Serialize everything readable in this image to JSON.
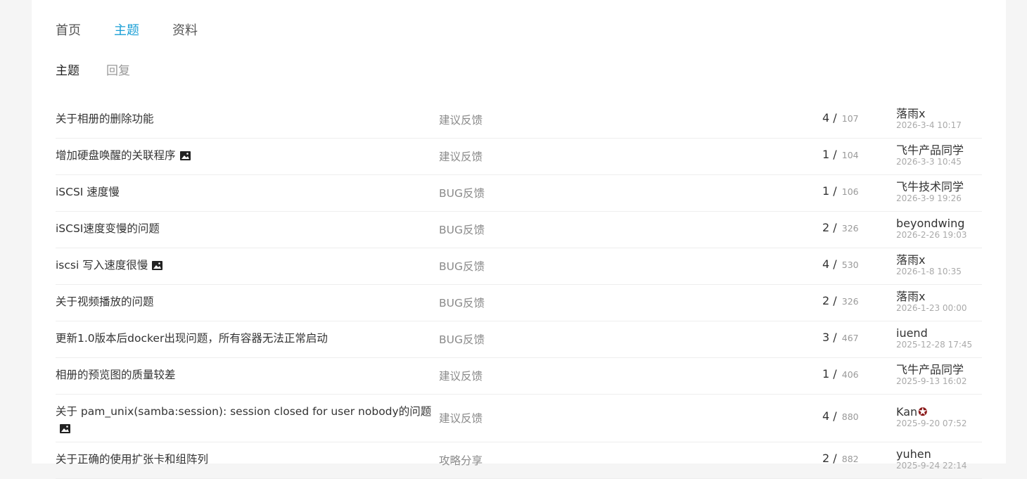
{
  "nav": {
    "tabs": [
      "首页",
      "主题",
      "资料"
    ],
    "active": 1
  },
  "subnav": {
    "tabs": [
      "主题",
      "回复"
    ],
    "active": 0
  },
  "threads": [
    {
      "title": "关于相册的删除功能",
      "has_image": false,
      "category": "建议反馈",
      "replies": "4",
      "views": "107",
      "user": "落雨x",
      "time": "2026-3-4 10:17"
    },
    {
      "title": "增加硬盘唤醒的关联程序",
      "has_image": true,
      "category": "建议反馈",
      "replies": "1",
      "views": "104",
      "user": "飞牛产品同学",
      "time": "2026-3-3 10:45"
    },
    {
      "title": "iSCSI 速度慢",
      "has_image": false,
      "category": "BUG反馈",
      "replies": "1",
      "views": "106",
      "user": "飞牛技术同学",
      "time": "2026-3-9 19:26"
    },
    {
      "title": "iSCSI速度变慢的问题",
      "has_image": false,
      "category": "BUG反馈",
      "replies": "2",
      "views": "326",
      "user": "beyondwing",
      "time": "2026-2-26 19:03"
    },
    {
      "title": "iscsi 写入速度很慢",
      "has_image": true,
      "category": "BUG反馈",
      "replies": "4",
      "views": "530",
      "user": "落雨x",
      "time": "2026-1-8 10:35"
    },
    {
      "title": "关于视频播放的问题",
      "has_image": false,
      "category": "BUG反馈",
      "replies": "2",
      "views": "326",
      "user": "落雨x",
      "time": "2026-1-23 00:00"
    },
    {
      "title": "更新1.0版本后docker出现问题，所有容器无法正常启动",
      "has_image": false,
      "category": "BUG反馈",
      "replies": "3",
      "views": "467",
      "user": "iuend",
      "time": "2025-12-28 17:45"
    },
    {
      "title": "相册的预览图的质量较差",
      "has_image": false,
      "category": "建议反馈",
      "replies": "1",
      "views": "406",
      "user": "飞牛产品同学",
      "time": "2025-9-13 16:02"
    },
    {
      "title": "关于 pam_unix(samba:session): session closed for user nobody的问题",
      "has_image": true,
      "category": "建议反馈",
      "replies": "4",
      "views": "880",
      "user": "Kan",
      "user_badge": "✪",
      "time": "2025-9-20 07:52",
      "tall": true
    },
    {
      "title": "关于正确的使用扩张卡和组阵列",
      "has_image": false,
      "category": "攻略分享",
      "replies": "2",
      "views": "882",
      "user": "yuhen",
      "time": "2025-9-24 22:14"
    }
  ],
  "colors": {
    "accent": "#1a9fd6"
  }
}
